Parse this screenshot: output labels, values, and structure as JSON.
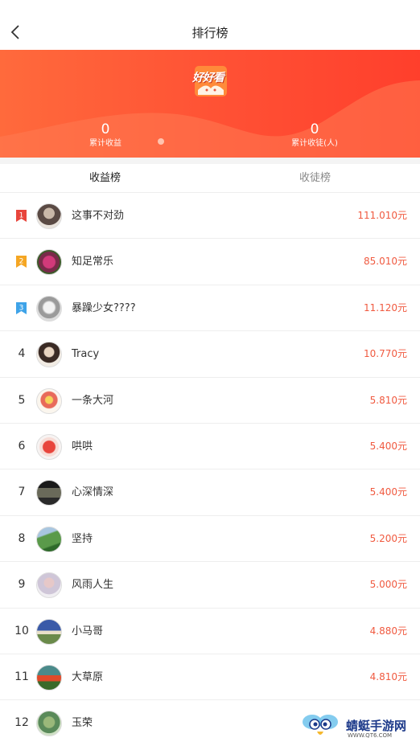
{
  "header": {
    "title": "排行榜",
    "back_icon": "chevron-left-icon"
  },
  "banner": {
    "logo_text": "好好看",
    "stats": [
      {
        "value": "0",
        "label": "累计收益"
      },
      {
        "value": "0",
        "label": "累计收徒(人)"
      }
    ],
    "colors": {
      "from": "#ff6a3c",
      "to": "#ff3f2c"
    }
  },
  "tabs": [
    {
      "label": "收益榜",
      "active": true
    },
    {
      "label": "收徒榜",
      "active": false
    }
  ],
  "ranking": [
    {
      "rank": "1",
      "name": "这事不对劲",
      "amount": "111.010元",
      "medal": "red"
    },
    {
      "rank": "2",
      "name": "知足常乐",
      "amount": "85.010元",
      "medal": "orange"
    },
    {
      "rank": "3",
      "name": "暴躁少女????",
      "amount": "11.120元",
      "medal": "blue"
    },
    {
      "rank": "4",
      "name": "Tracy",
      "amount": "10.770元"
    },
    {
      "rank": "5",
      "name": "一条大河",
      "amount": "5.810元"
    },
    {
      "rank": "6",
      "name": "哄哄",
      "amount": "5.400元"
    },
    {
      "rank": "7",
      "name": "心深情深",
      "amount": "5.400元"
    },
    {
      "rank": "8",
      "name": "坚持",
      "amount": "5.200元"
    },
    {
      "rank": "9",
      "name": "风雨人生",
      "amount": "5.000元"
    },
    {
      "rank": "10",
      "name": "小马哥",
      "amount": "4.880元"
    },
    {
      "rank": "11",
      "name": "大草原",
      "amount": "4.810元"
    },
    {
      "rank": "12",
      "name": "玉荣",
      "amount": ""
    }
  ],
  "watermark": {
    "text": "蜻蜓手游网",
    "sub": "WWW.QT6.COM"
  },
  "colors": {
    "accent": "#f05a40",
    "medal_red": "#e8453c",
    "medal_orange": "#f5a623",
    "medal_blue": "#3ea3e8"
  }
}
